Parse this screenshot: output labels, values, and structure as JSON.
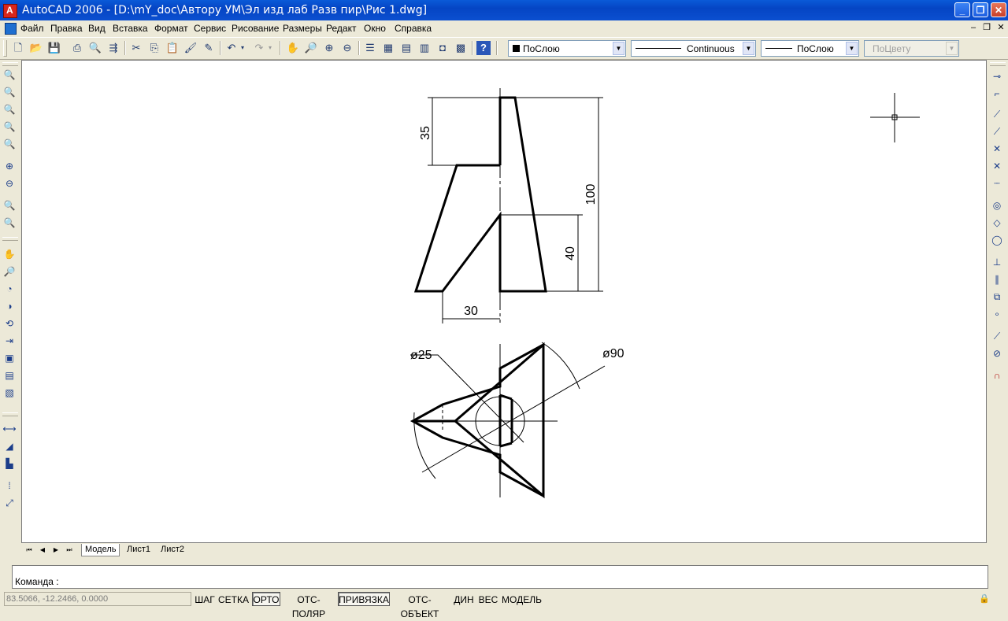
{
  "window": {
    "title": "AutoCAD 2006 - [D:\\mY_doc\\Автору УМ\\Эл изд лаб Разв пир\\Рис 1.dwg]"
  },
  "menu": [
    "Файл",
    "Правка",
    "Вид",
    "Вставка",
    "Формат",
    "Сервис",
    "Рисование",
    "Размеры",
    "Редакт",
    "Окно",
    "Справка"
  ],
  "properties": {
    "color": "ПоСлою",
    "linetype": "Continuous",
    "lineweight": "ПоСлою",
    "plotstyle": "ПоЦвету"
  },
  "dimensions": {
    "d35": "35",
    "d100": "100",
    "d40": "40",
    "d30": "30",
    "dia25": "ø25",
    "dia90": "ø90"
  },
  "layout_tabs": [
    "Модель",
    "Лист1",
    "Лист2"
  ],
  "command": {
    "prompt": "Команда :"
  },
  "status": {
    "coords": "83.5066, -12.2466, 0.0000",
    "buttons": [
      "ШАГ",
      "СЕТКА",
      "ОРТО",
      "ОТС-ПОЛЯР",
      "ПРИВЯЗКА",
      "ОТС-ОБЪЕКТ",
      "ДИН",
      "ВЕС",
      "МОДЕЛЬ"
    ]
  }
}
